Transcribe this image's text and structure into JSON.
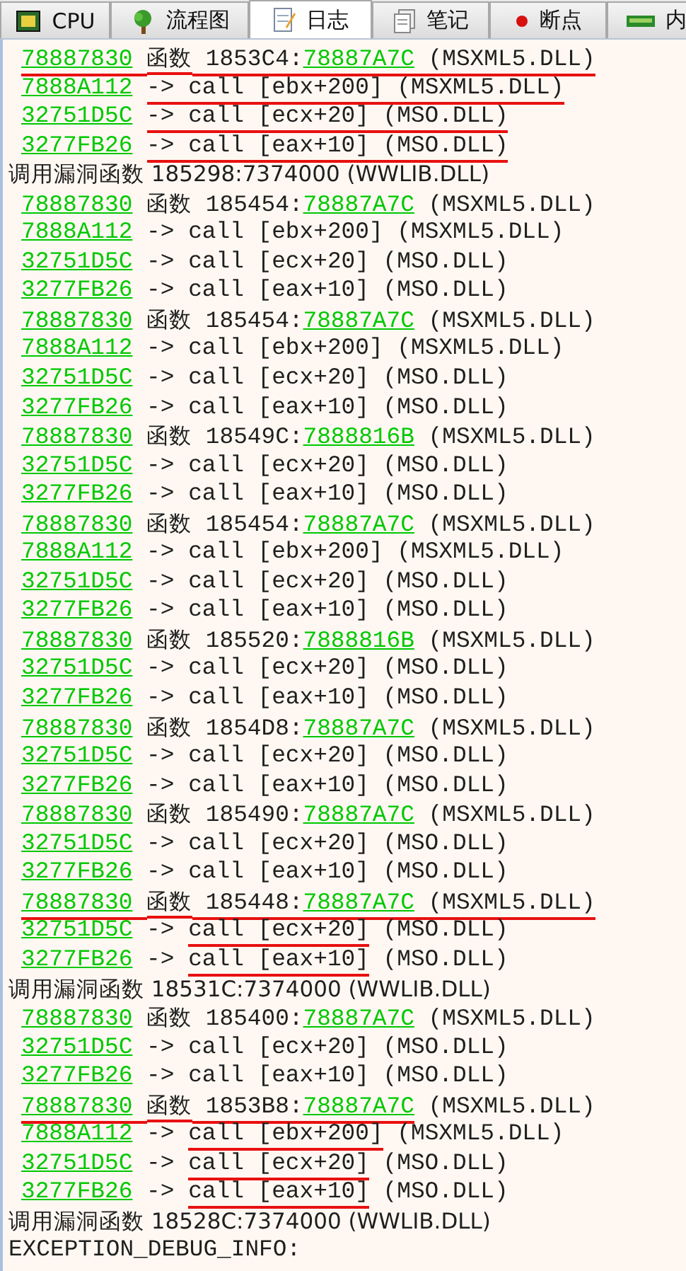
{
  "tabs": [
    {
      "label": "CPU",
      "selected": false
    },
    {
      "label": "流程图",
      "selected": false
    },
    {
      "label": "日志",
      "selected": true
    },
    {
      "label": "笔记",
      "selected": false
    },
    {
      "label": "断点",
      "selected": false
    },
    {
      "label": "内",
      "selected": false
    }
  ],
  "log": [
    {
      "kind": "function",
      "address": "78887830",
      "label": "函数",
      "offset": "1853C4:",
      "target": "78887A7C",
      "module": "(MSXML5.DLL)",
      "marked_address": true,
      "marked_body": true,
      "marked_module": true
    },
    {
      "kind": "call",
      "address": "7888A112",
      "arrow": "->",
      "instruction": "call [ebx+200]",
      "module": "(MSXML5.DLL)",
      "marked_address": false,
      "marked_arrow": true,
      "marked_instruction": true,
      "marked_module": true
    },
    {
      "kind": "call",
      "address": "32751D5C",
      "arrow": "->",
      "instruction": "call [ecx+20]",
      "module": "(MSO.DLL)",
      "marked_address": false,
      "marked_arrow": true,
      "marked_instruction": true,
      "marked_module": true
    },
    {
      "kind": "call",
      "address": "3277FB26",
      "arrow": "->",
      "instruction": "call [eax+10]",
      "module": "(MSO.DLL)",
      "marked_address": false,
      "marked_arrow": true,
      "marked_instruction": true,
      "marked_module": true
    },
    {
      "kind": "vuln",
      "text": "调用漏洞函数 185298:7374000 (WWLIB.DLL)",
      "marked": false
    },
    {
      "kind": "function",
      "address": "78887830",
      "label": "函数",
      "offset": "185454:",
      "target": "78887A7C",
      "module": "(MSXML5.DLL)",
      "marked_address": false,
      "marked_body": false,
      "marked_module": false
    },
    {
      "kind": "call",
      "address": "7888A112",
      "arrow": "->",
      "instruction": "call [ebx+200]",
      "module": "(MSXML5.DLL)",
      "marked_address": false,
      "marked_arrow": false,
      "marked_instruction": false,
      "marked_module": false
    },
    {
      "kind": "call",
      "address": "32751D5C",
      "arrow": "->",
      "instruction": "call [ecx+20]",
      "module": "(MSO.DLL)",
      "marked_address": false,
      "marked_arrow": false,
      "marked_instruction": false,
      "marked_module": false
    },
    {
      "kind": "call",
      "address": "3277FB26",
      "arrow": "->",
      "instruction": "call [eax+10]",
      "module": "(MSO.DLL)",
      "marked_address": false,
      "marked_arrow": false,
      "marked_instruction": false,
      "marked_module": false
    },
    {
      "kind": "function",
      "address": "78887830",
      "label": "函数",
      "offset": "185454:",
      "target": "78887A7C",
      "module": "(MSXML5.DLL)",
      "marked_address": false,
      "marked_body": false,
      "marked_module": false
    },
    {
      "kind": "call",
      "address": "7888A112",
      "arrow": "->",
      "instruction": "call [ebx+200]",
      "module": "(MSXML5.DLL)",
      "marked_address": false,
      "marked_arrow": false,
      "marked_instruction": false,
      "marked_module": false
    },
    {
      "kind": "call",
      "address": "32751D5C",
      "arrow": "->",
      "instruction": "call [ecx+20]",
      "module": "(MSO.DLL)",
      "marked_address": false,
      "marked_arrow": false,
      "marked_instruction": false,
      "marked_module": false
    },
    {
      "kind": "call",
      "address": "3277FB26",
      "arrow": "->",
      "instruction": "call [eax+10]",
      "module": "(MSO.DLL)",
      "marked_address": false,
      "marked_arrow": false,
      "marked_instruction": false,
      "marked_module": false
    },
    {
      "kind": "function",
      "address": "78887830",
      "label": "函数",
      "offset": "18549C:",
      "target": "7888816B",
      "module": "(MSXML5.DLL)",
      "marked_address": false,
      "marked_body": false,
      "marked_module": false
    },
    {
      "kind": "call",
      "address": "32751D5C",
      "arrow": "->",
      "instruction": "call [ecx+20]",
      "module": "(MSO.DLL)",
      "marked_address": false,
      "marked_arrow": false,
      "marked_instruction": false,
      "marked_module": false
    },
    {
      "kind": "call",
      "address": "3277FB26",
      "arrow": "->",
      "instruction": "call [eax+10]",
      "module": "(MSO.DLL)",
      "marked_address": false,
      "marked_arrow": false,
      "marked_instruction": false,
      "marked_module": false
    },
    {
      "kind": "function",
      "address": "78887830",
      "label": "函数",
      "offset": "185454:",
      "target": "78887A7C",
      "module": "(MSXML5.DLL)",
      "marked_address": false,
      "marked_body": false,
      "marked_module": false
    },
    {
      "kind": "call",
      "address": "7888A112",
      "arrow": "->",
      "instruction": "call [ebx+200]",
      "module": "(MSXML5.DLL)",
      "marked_address": false,
      "marked_arrow": false,
      "marked_instruction": false,
      "marked_module": false
    },
    {
      "kind": "call",
      "address": "32751D5C",
      "arrow": "->",
      "instruction": "call [ecx+20]",
      "module": "(MSO.DLL)",
      "marked_address": false,
      "marked_arrow": false,
      "marked_instruction": false,
      "marked_module": false
    },
    {
      "kind": "call",
      "address": "3277FB26",
      "arrow": "->",
      "instruction": "call [eax+10]",
      "module": "(MSO.DLL)",
      "marked_address": false,
      "marked_arrow": false,
      "marked_instruction": false,
      "marked_module": false
    },
    {
      "kind": "function",
      "address": "78887830",
      "label": "函数",
      "offset": "185520:",
      "target": "7888816B",
      "module": "(MSXML5.DLL)",
      "marked_address": false,
      "marked_body": false,
      "marked_module": false
    },
    {
      "kind": "call",
      "address": "32751D5C",
      "arrow": "->",
      "instruction": "call [ecx+20]",
      "module": "(MSO.DLL)",
      "marked_address": false,
      "marked_arrow": false,
      "marked_instruction": false,
      "marked_module": false
    },
    {
      "kind": "call",
      "address": "3277FB26",
      "arrow": "->",
      "instruction": "call [eax+10]",
      "module": "(MSO.DLL)",
      "marked_address": false,
      "marked_arrow": false,
      "marked_instruction": false,
      "marked_module": false
    },
    {
      "kind": "function",
      "address": "78887830",
      "label": "函数",
      "offset": "1854D8:",
      "target": "78887A7C",
      "module": "(MSXML5.DLL)",
      "marked_address": false,
      "marked_body": false,
      "marked_module": false
    },
    {
      "kind": "call",
      "address": "32751D5C",
      "arrow": "->",
      "instruction": "call [ecx+20]",
      "module": "(MSO.DLL)",
      "marked_address": false,
      "marked_arrow": false,
      "marked_instruction": false,
      "marked_module": false
    },
    {
      "kind": "call",
      "address": "3277FB26",
      "arrow": "->",
      "instruction": "call [eax+10]",
      "module": "(MSO.DLL)",
      "marked_address": false,
      "marked_arrow": false,
      "marked_instruction": false,
      "marked_module": false
    },
    {
      "kind": "function",
      "address": "78887830",
      "label": "函数",
      "offset": "185490:",
      "target": "78887A7C",
      "module": "(MSXML5.DLL)",
      "marked_address": false,
      "marked_body": false,
      "marked_module": false
    },
    {
      "kind": "call",
      "address": "32751D5C",
      "arrow": "->",
      "instruction": "call [ecx+20]",
      "module": "(MSO.DLL)",
      "marked_address": false,
      "marked_arrow": false,
      "marked_instruction": false,
      "marked_module": false
    },
    {
      "kind": "call",
      "address": "3277FB26",
      "arrow": "->",
      "instruction": "call [eax+10]",
      "module": "(MSO.DLL)",
      "marked_address": false,
      "marked_arrow": false,
      "marked_instruction": false,
      "marked_module": false
    },
    {
      "kind": "function",
      "address": "78887830",
      "label": "函数",
      "offset": "185448:",
      "target": "78887A7C",
      "module": "(MSXML5.DLL)",
      "marked_address": true,
      "marked_body": true,
      "marked_module": true
    },
    {
      "kind": "call",
      "address": "32751D5C",
      "arrow": "->",
      "instruction": "call [ecx+20]",
      "module": "(MSO.DLL)",
      "marked_address": false,
      "marked_arrow": false,
      "marked_instruction": true,
      "marked_module": false
    },
    {
      "kind": "call",
      "address": "3277FB26",
      "arrow": "->",
      "instruction": "call [eax+10]",
      "module": "(MSO.DLL)",
      "marked_address": false,
      "marked_arrow": false,
      "marked_instruction": true,
      "marked_module": false
    },
    {
      "kind": "vuln",
      "text": "调用漏洞函数 18531C:7374000 (WWLIB.DLL)",
      "marked": false
    },
    {
      "kind": "function",
      "address": "78887830",
      "label": "函数",
      "offset": "185400:",
      "target": "78887A7C",
      "module": "(MSXML5.DLL)",
      "marked_address": false,
      "marked_body": false,
      "marked_module": false
    },
    {
      "kind": "call",
      "address": "32751D5C",
      "arrow": "->",
      "instruction": "call [ecx+20]",
      "module": "(MSO.DLL)",
      "marked_address": false,
      "marked_arrow": false,
      "marked_instruction": false,
      "marked_module": false
    },
    {
      "kind": "call",
      "address": "3277FB26",
      "arrow": "->",
      "instruction": "call [eax+10]",
      "module": "(MSO.DLL)",
      "marked_address": false,
      "marked_arrow": false,
      "marked_instruction": false,
      "marked_module": false
    },
    {
      "kind": "function",
      "address": "78887830",
      "label": "函数",
      "offset": "1853B8:",
      "target": "78887A7C",
      "module": "(MSXML5.DLL)",
      "marked_address": true,
      "marked_body": true,
      "marked_module": false
    },
    {
      "kind": "call",
      "address": "7888A112",
      "arrow": "->",
      "instruction": "call [ebx+200]",
      "module": "(MSXML5.DLL)",
      "marked_address": false,
      "marked_arrow": false,
      "marked_instruction": true,
      "marked_module": false
    },
    {
      "kind": "call",
      "address": "32751D5C",
      "arrow": "->",
      "instruction": "call [ecx+20]",
      "module": "(MSO.DLL)",
      "marked_address": false,
      "marked_arrow": false,
      "marked_instruction": true,
      "marked_module": false
    },
    {
      "kind": "call",
      "address": "3277FB26",
      "arrow": "->",
      "instruction": "call [eax+10]",
      "module": "(MSO.DLL)",
      "marked_address": false,
      "marked_arrow": false,
      "marked_instruction": true,
      "marked_module": false
    },
    {
      "kind": "vuln",
      "text": "调用漏洞函数 18528C:7374000 (WWLIB.DLL)",
      "marked": false
    },
    {
      "kind": "plain",
      "text": "EXCEPTION_DEBUG_INFO:",
      "marked": false
    }
  ]
}
